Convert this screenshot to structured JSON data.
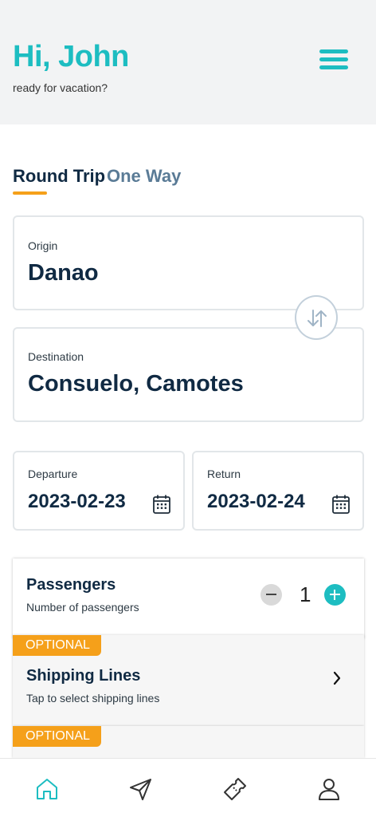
{
  "header": {
    "greeting": "Hi, John",
    "subtitle": "ready for vacation?"
  },
  "tabs": [
    {
      "label": "Round Trip",
      "active": true
    },
    {
      "label": "One Way",
      "active": false
    }
  ],
  "origin": {
    "label": "Origin",
    "value": "Danao"
  },
  "destination": {
    "label": "Destination",
    "value": "Consuelo, Camotes"
  },
  "departure": {
    "label": "Departure",
    "value": "2023-02-23"
  },
  "return": {
    "label": "Return",
    "value": "2023-02-24"
  },
  "passengers": {
    "title": "Passengers",
    "subtitle": "Number of passengers",
    "count": "1"
  },
  "shipping": {
    "badge": "OPTIONAL",
    "title": "Shipping Lines",
    "subtitle": "Tap to select shipping lines"
  },
  "next_optional": {
    "badge": "OPTIONAL"
  },
  "nav": [
    "home-icon",
    "send-icon",
    "ticket-icon",
    "profile-icon"
  ],
  "colors": {
    "accent": "#1dbdc1",
    "badge": "#f5a01a",
    "text": "#102a43"
  }
}
